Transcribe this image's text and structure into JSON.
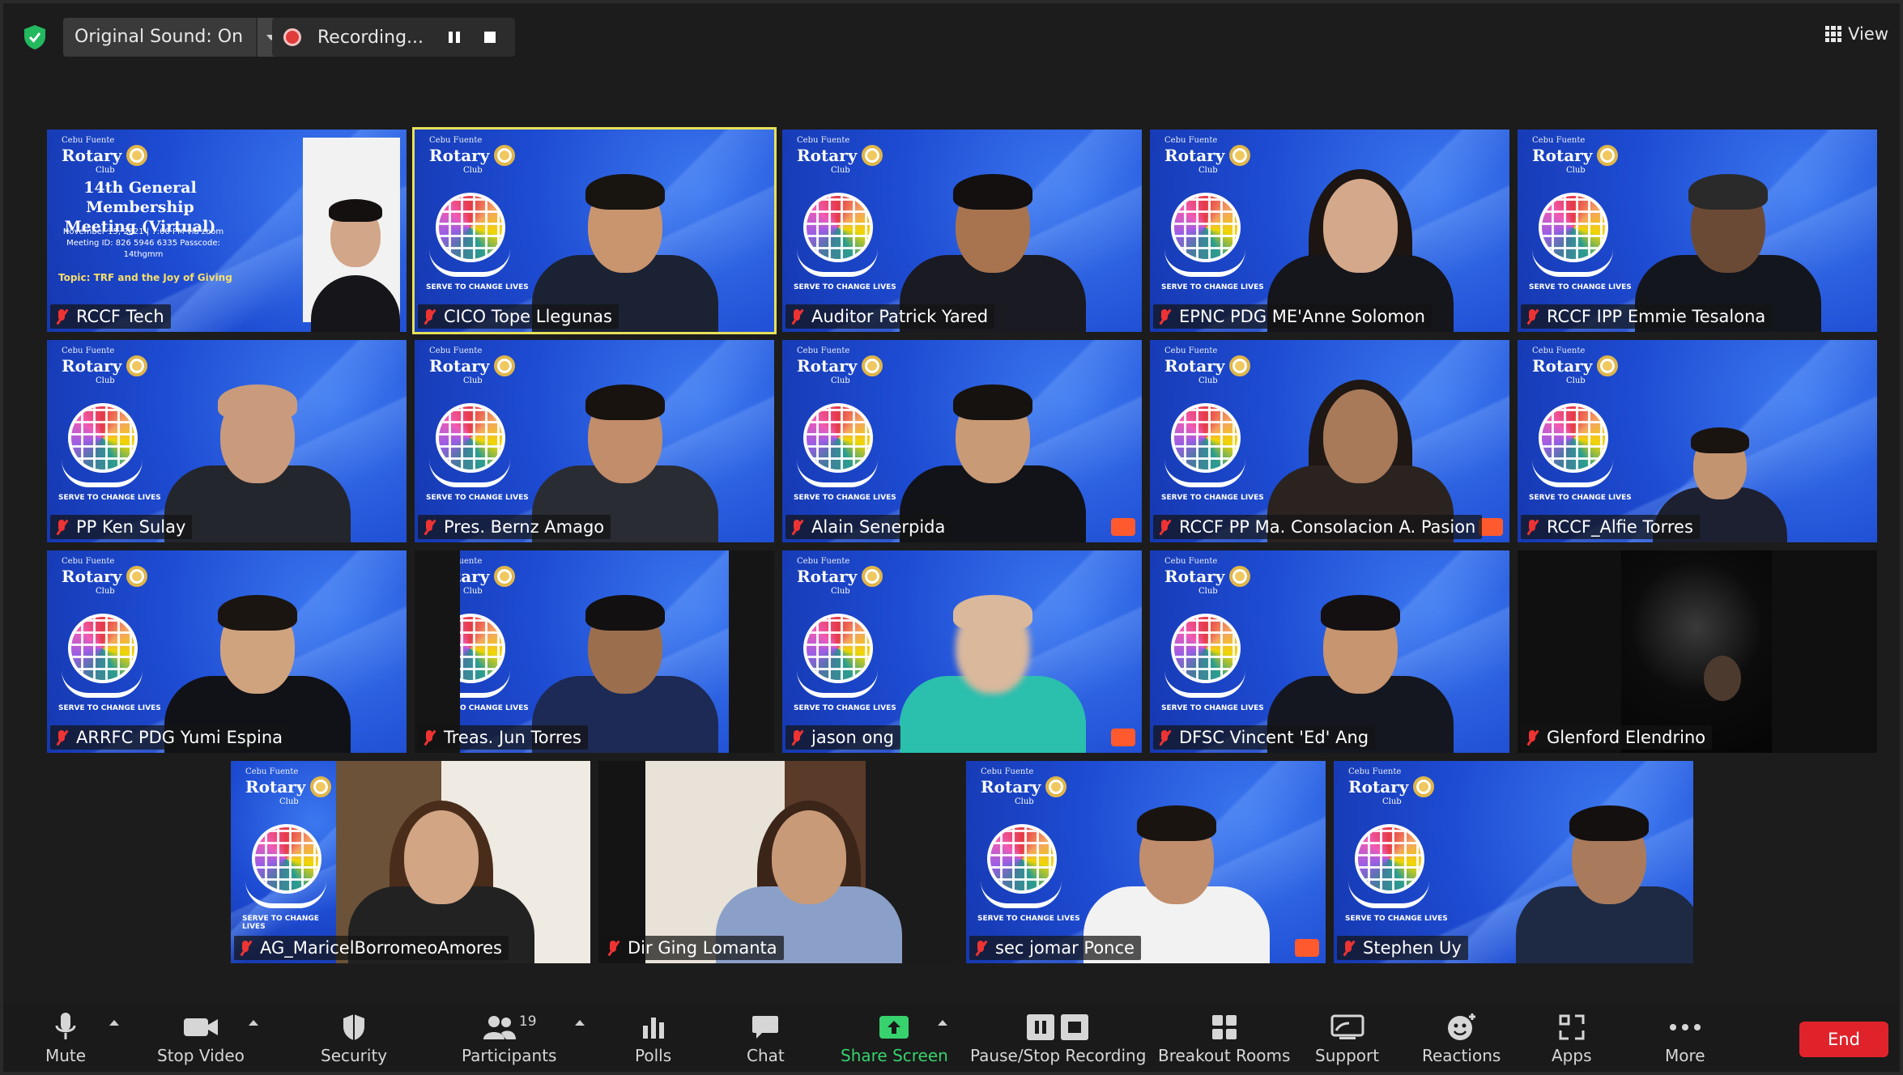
{
  "topbar": {
    "original_sound": "Original Sound: On",
    "recording": "Recording...",
    "view": "View"
  },
  "flyer": {
    "club_small": "Cebu Fuente",
    "rotary": "Rotary",
    "club": "Club",
    "serve": "SERVE TO CHANGE LIVES",
    "title_line1": "14th General Membership",
    "title_line2": "Meeting (Virtual)",
    "details": "November 15, 2021 | 7:00 PM via zoom Meeting ID: 826 5946 6335 Passcode: 14thgmm",
    "topic": "Topic: TRF and the Joy of Giving"
  },
  "tile_text": {
    "club_small": "Cebu Fuente",
    "rotary": "Rotary",
    "club": "Club",
    "serve": "SERVE TO CHANGE LIVES"
  },
  "participants": [
    {
      "name": "RCCF Tech"
    },
    {
      "name": "CICO Tope Llegunas"
    },
    {
      "name": "Auditor Patrick Yared"
    },
    {
      "name": "EPNC PDG ME'Anne Solomon"
    },
    {
      "name": "RCCF IPP Emmie Tesalona"
    },
    {
      "name": "PP Ken Sulay"
    },
    {
      "name": "Pres. Bernz Amago"
    },
    {
      "name": "Alain Senerpida"
    },
    {
      "name": "RCCF PP Ma. Consolacion A. Pasion"
    },
    {
      "name": "RCCF_Alfie Torres"
    },
    {
      "name": "ARRFC PDG Yumi Espina"
    },
    {
      "name": "Treas. Jun Torres"
    },
    {
      "name": "jason ong"
    },
    {
      "name": "DFSC Vincent 'Ed' Ang"
    },
    {
      "name": "Glenford Elendrino"
    },
    {
      "name": "AG_MaricelBorromeoAmores"
    },
    {
      "name": "Dir Ging Lomanta"
    },
    {
      "name": "sec jomar Ponce"
    },
    {
      "name": "Stephen Uy"
    }
  ],
  "toolbar": {
    "mute": "Mute",
    "stop_video": "Stop Video",
    "security": "Security",
    "participants": "Participants",
    "participants_count": "19",
    "polls": "Polls",
    "chat": "Chat",
    "share_screen": "Share Screen",
    "pause_stop_recording": "Pause/Stop Recording",
    "breakout_rooms": "Breakout Rooms",
    "support": "Support",
    "reactions": "Reactions",
    "apps": "Apps",
    "more": "More",
    "end": "End"
  },
  "colors": {
    "active_speaker_border": "#e6e05a",
    "share_green": "#37d26d",
    "end_red": "#e0232b",
    "muted_red": "#ee3333"
  }
}
